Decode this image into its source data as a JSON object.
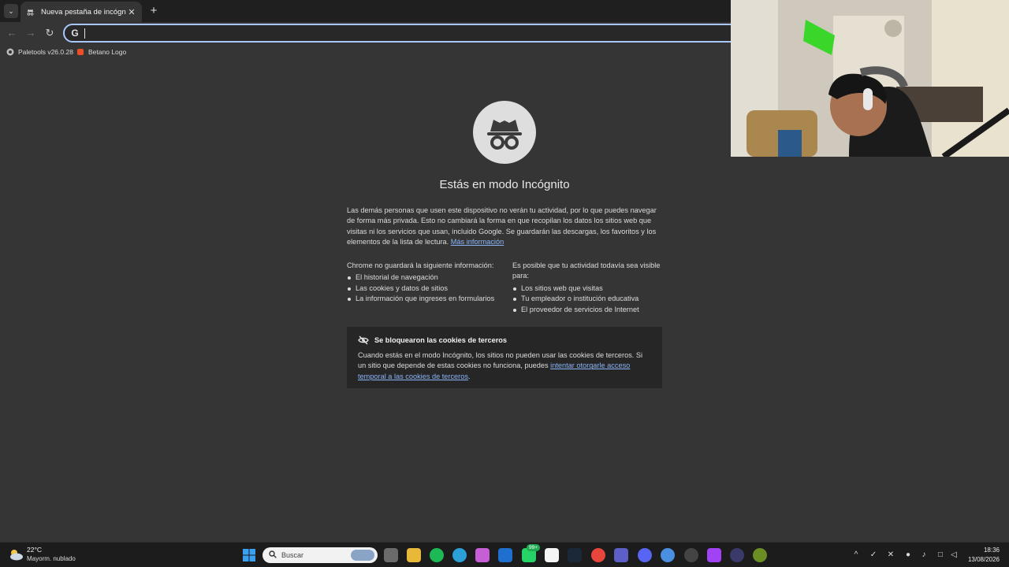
{
  "browser": {
    "tab_title": "Nueva pestaña de incógnito",
    "tab_close": "✕",
    "new_tab": "+",
    "tab_menu": "⌄",
    "nav": {
      "back": "←",
      "forward": "→",
      "reload": "↻"
    },
    "omnibox": {
      "value": "",
      "engine_glyph": "G"
    },
    "bookmarks": [
      {
        "label": "Paletools v26.0.28",
        "icon": "paletools-icon"
      },
      {
        "label": "Betano Logo",
        "icon": "betano-icon"
      }
    ]
  },
  "incognito_page": {
    "headline": "Estás en modo Incógnito",
    "intro": "Las demás personas que usen este dispositivo no verán tu actividad, por lo que puedes navegar de forma más privada. Esto no cambiará la forma en que recopilan los datos los sitios web que visitas ni los servicios que usan, incluido Google. Se guardarán las descargas, los favoritos y los elementos de la lista de lectura.",
    "learn_more": "Más información",
    "not_saved": {
      "title": "Chrome no guardará la siguiente información:",
      "items": [
        "El historial de navegación",
        "Las cookies y datos de sitios",
        "La información que ingreses en formularios"
      ]
    },
    "visible_to": {
      "title": "Es posible que tu actividad todavía sea visible para:",
      "items": [
        "Los sitios web que visitas",
        "Tu empleador o institución educativa",
        "El proveedor de servicios de Internet"
      ]
    },
    "cookie_notice": {
      "title": "Se bloquearon las cookies de terceros",
      "body": "Cuando estás en el modo Incógnito, los sitios no pueden usar las cookies de terceros. Si un sitio que depende de estas cookies no funciona, puedes",
      "link": "intentar otorgarle acceso temporal a las cookies de terceros",
      "end": "."
    }
  },
  "taskbar": {
    "weather_temp": "22°C",
    "weather_cond": "Mayorm. nublado",
    "search_placeholder": "Buscar",
    "whatsapp_badge": "99+",
    "time": "18:36",
    "date": "13/08/2026"
  },
  "colors": {
    "accent": "#8ab4f8",
    "omnibox_border": "#a8c7fa",
    "background": "#353535"
  }
}
